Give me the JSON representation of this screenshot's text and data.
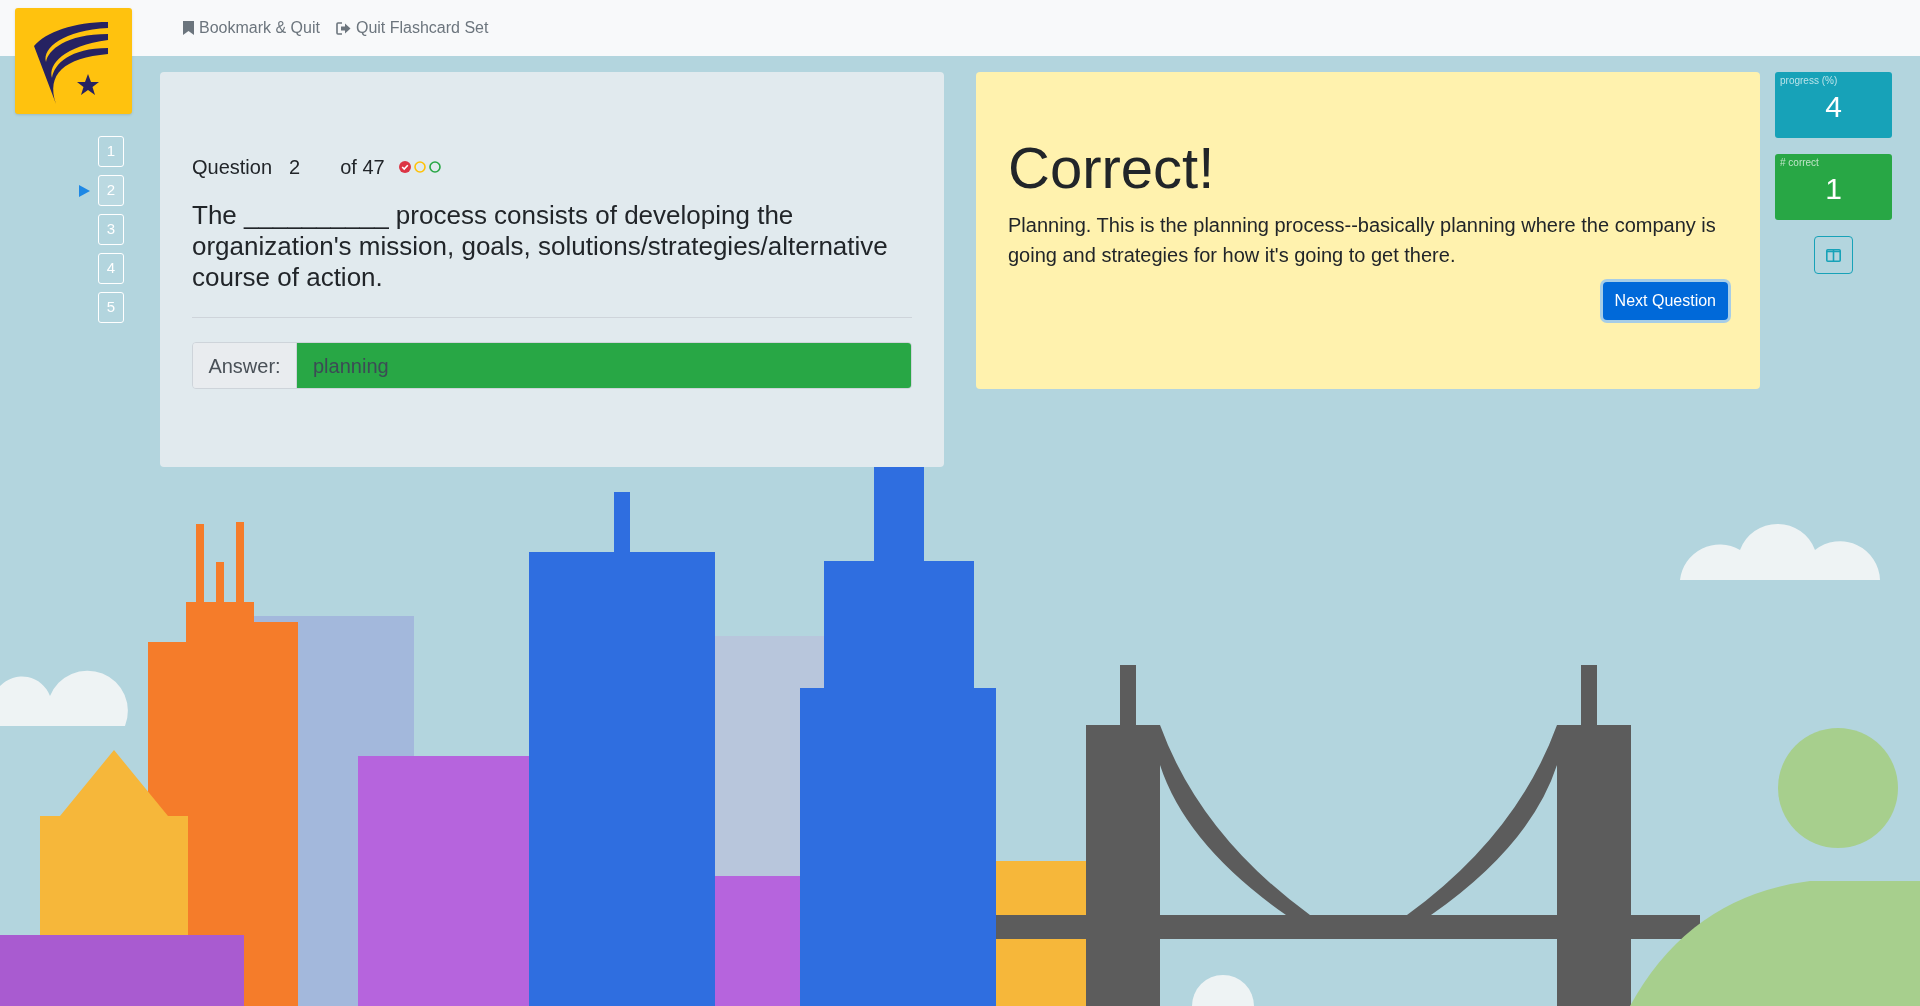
{
  "nav": {
    "links": [
      {
        "kind": "bookmark",
        "label": "Bookmark & Quit"
      },
      {
        "kind": "exit",
        "label": "Quit Flashcard Set"
      }
    ]
  },
  "question_nav": [
    {
      "label": "1",
      "selected": false
    },
    {
      "label": "2",
      "selected": true
    },
    {
      "label": "3",
      "selected": false
    },
    {
      "label": "4",
      "selected": false
    },
    {
      "label": "5",
      "selected": false
    }
  ],
  "question": {
    "label": "Question",
    "number": "2",
    "total": "of 47",
    "indicators": [
      {
        "kind": "checked",
        "color": "#dc3545"
      },
      {
        "kind": "empty",
        "color": "#ffc107"
      },
      {
        "kind": "empty",
        "color": "#28a745"
      }
    ],
    "text": "The __________ process consists of developing the organization's mission, goals, solutions/strategies/alternative course of action.",
    "answer_label": "Answer:",
    "answer": "planning",
    "answer_correct": true
  },
  "feedback": {
    "title": "Correct!",
    "explanation": "Planning. This is the planning process--basically planning where the company is going and strategies for how it's going to get there.",
    "button": "Next Question"
  },
  "stats": [
    {
      "label": "progress (%)",
      "value": "4",
      "color": "#17a2b8"
    },
    {
      "label": "# correct",
      "value": "1",
      "color": "#28a745"
    }
  ]
}
